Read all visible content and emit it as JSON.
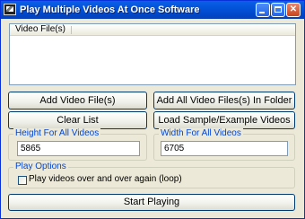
{
  "window": {
    "title": "Play Multiple Videos At Once Software",
    "minimize_glyph": "",
    "maximize_glyph": "",
    "close_glyph": "✕"
  },
  "file_list": {
    "column_header": "Video File(s)",
    "items": []
  },
  "buttons": {
    "add_files": "Add Video File(s)",
    "add_folder": "Add All Video Files(s) In Folder",
    "clear_list": "Clear List",
    "load_sample": "Load Sample/Example Videos",
    "start": "Start Playing"
  },
  "height_group": {
    "legend": "Height For All Videos",
    "value": "5865"
  },
  "width_group": {
    "legend": "Width For All Videos",
    "value": "6705"
  },
  "play_options": {
    "legend": "Play Options",
    "loop_label": "Play videos over and over again (loop)",
    "loop_checked": false
  },
  "colors": {
    "titlebar": "#0353d8",
    "group_legend": "#0046d5",
    "window_bg": "#ece9d8"
  }
}
